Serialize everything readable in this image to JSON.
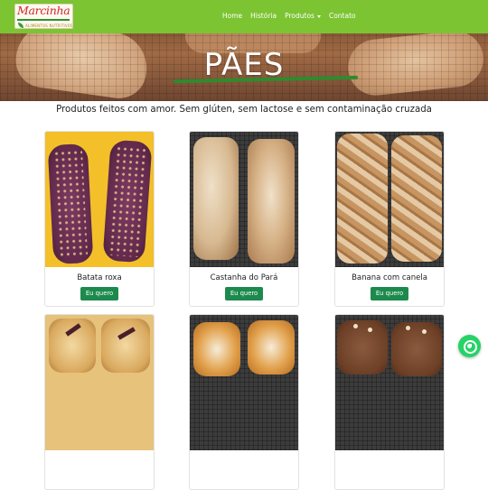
{
  "brand": {
    "name": "Marcinha",
    "tagline": "ALIMENTOS NUTRITIVOS"
  },
  "nav": {
    "items": [
      "Home",
      "História",
      "Produtos",
      "Contato"
    ]
  },
  "hero": {
    "title": "PÃES"
  },
  "subtitle": "Produtos feitos com amor. Sem glúten, sem lactose e sem contaminação cruzada",
  "products": [
    {
      "name": "Batata roxa",
      "button": "Eu quero"
    },
    {
      "name": "Castanha do Pará",
      "button": "Eu quero"
    },
    {
      "name": "Banana com canela",
      "button": "Eu quero"
    }
  ],
  "colors": {
    "navbar": "#7cc432",
    "button": "#1d8a4d",
    "whatsapp": "#25d366"
  },
  "icons": {
    "dropdown": "chevron-down-icon",
    "floating_action": "whatsapp-icon"
  }
}
